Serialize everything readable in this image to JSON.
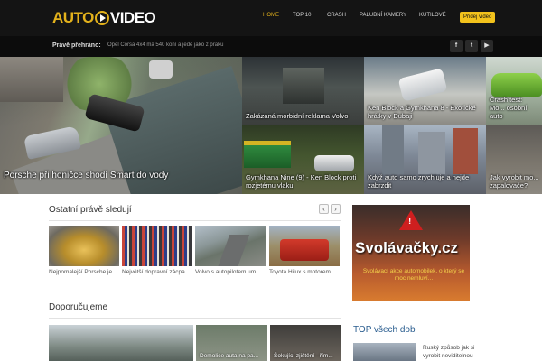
{
  "header": {
    "logo_part1": "AUTO",
    "logo_part2": "VIDEO",
    "nav": [
      "HOME",
      "TOP 10",
      "CRASH",
      "PALUBNÍ KAMERY",
      "KUTILOVÉ"
    ],
    "add_video": "Přidej video",
    "accent_color": "#e3b21c"
  },
  "newsbar": {
    "label": "Právě přehráno:",
    "text": "Opel Corsa 4x4 má 540 koní a jede jako z praku",
    "social": [
      {
        "icon": "facebook-icon",
        "glyph": "f"
      },
      {
        "icon": "twitter-icon",
        "glyph": "t"
      },
      {
        "icon": "youtube-icon",
        "glyph": "▶"
      }
    ]
  },
  "hero": {
    "main": "Porsche při honičce shodí Smart do vody",
    "tiles": [
      "Zakázaná morbidní reklama Volvo",
      "Ken Block a Gymkhana 8 - Exotické hrátky v Dubaji",
      "Crash test: Mo... osobní auto",
      "Gymkhana Nine (9) - Ken Block proti rozjetému vlaku",
      "Když auto samo zrychluje a nejde zabrzdit",
      "Jak vyrobit mo... zapalovače?"
    ]
  },
  "others": {
    "title": "Ostatní právě sledují",
    "prev": "‹",
    "next": "›",
    "items": [
      "Nejpomalejší Porsche je...",
      "Největší dopravní zácpa...",
      "Volvo s autopilotem um...",
      "Toyota Hilux s motorem"
    ]
  },
  "ad": {
    "title": "Svolávačky.cz",
    "subtitle": "Svolávací akce automobilek, o který se moc nemluví..."
  },
  "recommended": {
    "title": "Doporučujeme",
    "items": [
      "",
      "Demolice auta na pa...",
      "Šokující zjištění - řím..."
    ]
  },
  "top": {
    "title": "TOP všech dob",
    "item": "Ruský způsob jak si vyrobit neviditelnou"
  }
}
